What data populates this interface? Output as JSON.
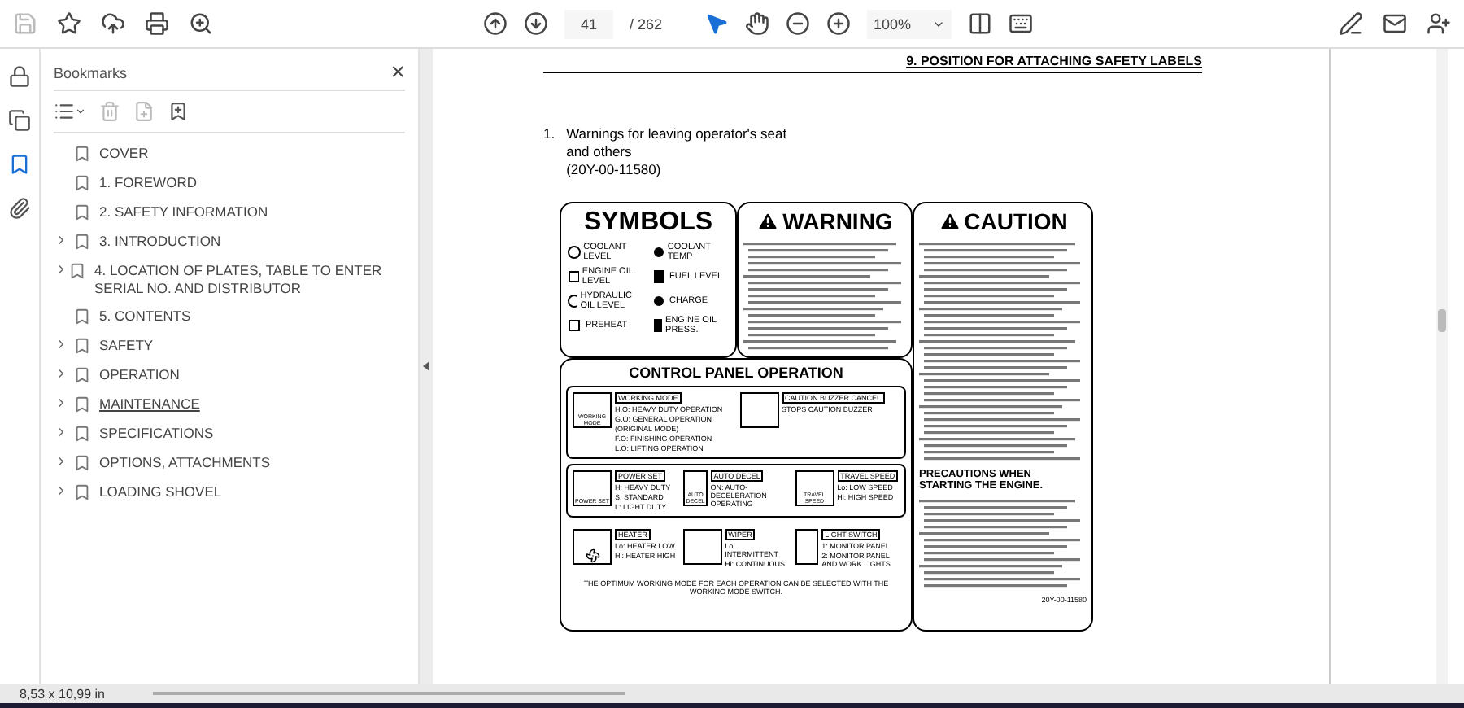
{
  "toolbar": {
    "page_current": "41",
    "page_total": "/ 262",
    "zoom": "100%"
  },
  "rail": [
    {
      "selected": false
    },
    {
      "selected": false
    },
    {
      "selected": true
    },
    {
      "selected": false
    }
  ],
  "bookmarks": {
    "title": "Bookmarks",
    "close": "×",
    "items": [
      {
        "label": "COVER",
        "expandable": false,
        "hovered": false
      },
      {
        "label": "1. FOREWORD",
        "expandable": false,
        "hovered": false
      },
      {
        "label": "2. SAFETY INFORMATION",
        "expandable": false,
        "hovered": false
      },
      {
        "label": "3. INTRODUCTION",
        "expandable": true,
        "hovered": false
      },
      {
        "label": "4. LOCATION OF PLATES, TABLE TO ENTER SERIAL NO. AND DISTRIBUTOR",
        "expandable": true,
        "hovered": false
      },
      {
        "label": "5. CONTENTS",
        "expandable": false,
        "hovered": false
      },
      {
        "label": "SAFETY",
        "expandable": true,
        "hovered": false
      },
      {
        "label": "OPERATION",
        "expandable": true,
        "hovered": false
      },
      {
        "label": "MAINTENANCE",
        "expandable": true,
        "hovered": true
      },
      {
        "label": "SPECIFICATIONS",
        "expandable": true,
        "hovered": false
      },
      {
        "label": "OPTIONS, ATTACHMENTS",
        "expandable": true,
        "hovered": false
      },
      {
        "label": "LOADING SHOVEL",
        "expandable": true,
        "hovered": false
      }
    ]
  },
  "page": {
    "header": "9. POSITION FOR ATTACHING SAFETY LABELS",
    "item_number": "1.",
    "item_lines": [
      "Warnings for leaving operator's seat",
      "and others",
      "(20Y-00-11580)"
    ],
    "label": {
      "symbols_title": "SYMBOLS",
      "symbols": [
        "COOLANT LEVEL",
        "COOLANT TEMP",
        "ENGINE OIL LEVEL",
        "FUEL LEVEL",
        "HYDRAULIC OIL LEVEL",
        "CHARGE",
        "PREHEAT",
        "ENGINE OIL PRESS."
      ],
      "warning_title": "WARNING",
      "caution_title": "CAUTION",
      "caution_heading": "PRECAUTIONS WHEN STARTING THE ENGINE.",
      "part_number": "20Y-00-11580",
      "panel_title": "CONTROL PANEL OPERATION",
      "groups": [
        {
          "framed": true,
          "switches": [
            {
              "switch_label": "WORKING MODE",
              "title": "WORKING MODE",
              "lines": [
                "H.O: HEAVY DUTY OPERATION",
                "G.O: GENERAL OPERATION",
                "(ORIGINAL MODE)",
                "F.O: FINISHING OPERATION",
                "L.O: LIFTING OPERATION"
              ]
            },
            {
              "title": "CAUTION BUZZER CANCEL",
              "lines": [
                "STOPS CAUTION BUZZER"
              ]
            }
          ]
        },
        {
          "framed": true,
          "switches": [
            {
              "switch_label": "POWER SET",
              "title": "POWER SET",
              "lines": [
                "H: HEAVY DUTY",
                "S: STANDARD",
                "L: LIGHT DUTY"
              ]
            },
            {
              "switch_label": "AUTO DECEL",
              "title": "AUTO DECEL",
              "lines": [
                "ON: AUTO-DECELERATION OPERATING"
              ]
            },
            {
              "switch_label": "TRAVEL SPEED",
              "title": "TRAVEL SPEED",
              "lines": [
                "Lo: LOW SPEED",
                "Hi: HIGH SPEED"
              ]
            }
          ]
        },
        {
          "framed": false,
          "switches": [
            {
              "title": "HEATER",
              "lines": [
                "Lo: HEATER LOW",
                "Hi: HEATER HIGH"
              ]
            },
            {
              "title": "WIPER",
              "lines": [
                "Lo: INTERMITTENT",
                "Hi: CONTINUOUS"
              ]
            },
            {
              "title": "LIGHT SWITCH",
              "lines": [
                "1: MONITOR PANEL",
                "2: MONITOR PANEL AND WORK LIGHTS"
              ]
            }
          ]
        }
      ],
      "panel_note": "THE OPTIMUM WORKING MODE FOR EACH OPERATION CAN BE SELECTED WITH THE WORKING MODE SWITCH."
    }
  },
  "status": {
    "page_size": "8,53 x 10,99 in"
  }
}
